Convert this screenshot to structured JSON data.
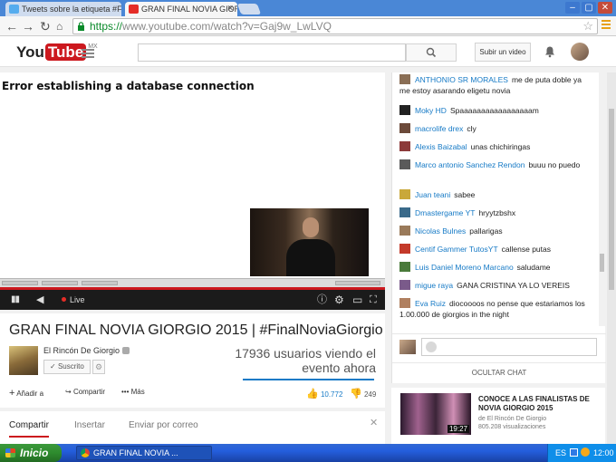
{
  "browser": {
    "tabs": [
      {
        "title": "Tweets sobre la etiqueta #Fi",
        "active": false
      },
      {
        "title": "GRAN FINAL NOVIA GIOR",
        "active": true
      }
    ],
    "url_scheme": "https://",
    "url_rest": "www.youtube.com/watch?v=Gaj9w_LwLVQ"
  },
  "yt_header": {
    "logo_you": "You",
    "logo_tube": "Tube",
    "logo_region": "MX",
    "upload_label": "Subir un video"
  },
  "player": {
    "error_text": "Error establishing a database connection",
    "live_label": "Live"
  },
  "video": {
    "title": "GRAN FINAL NOVIA GIORGIO 2015 | #FinalNoviaGiorgio",
    "channel": "El Rincón De Giorgio",
    "subscribe_label": "Suscrito",
    "viewers": "17936 usuarios viendo el evento ahora",
    "add_label": "Añadir a",
    "share_label": "Compartir",
    "more_label": "Más",
    "likes": "10.772",
    "dislikes": "249"
  },
  "share_tabs": [
    "Compartir",
    "Insertar",
    "Enviar por correo"
  ],
  "chat": {
    "messages": [
      {
        "user": "ANTHONIO SR MORALES",
        "text": "me de puta doble ya me estoy asarando eligetu novia"
      },
      {
        "user": "Moky HD",
        "text": "Spaaaaaaaaaaaaaaaaam"
      },
      {
        "user": "macrolife drex",
        "text": "cly"
      },
      {
        "user": "Alexis Baizabal",
        "text": "unas chichiringas"
      },
      {
        "user": "Marco antonio Sanchez Rendon",
        "text": "buuu no puedo"
      },
      {
        "user": "Juan teani",
        "text": "sabee"
      },
      {
        "user": "Dmastergame YT",
        "text": "hryytzbshx"
      },
      {
        "user": "Nicolas Bulnes",
        "text": "pallarigas"
      },
      {
        "user": "Centif Gammer TutosYT",
        "text": "callense putas"
      },
      {
        "user": "Luis Daniel Moreno Marcano",
        "text": "saludame"
      },
      {
        "user": "migue raya",
        "text": "GANA CRISTINA YA LO VEREIS"
      },
      {
        "user": "Eva Ruiz",
        "text": "diocoooos no pense que estariamos los 1.00.000 de giorgios in the night"
      }
    ],
    "hide_label": "OCULTAR CHAT"
  },
  "related": {
    "title": "CONOCE A LAS FINALISTAS DE NOVIA GIORGIO 2015",
    "channel": "de El Rincón De Giorgio",
    "views": "805.208 visualizaciones",
    "duration": "19:27"
  },
  "taskbar": {
    "start_label": "Inicio",
    "item_label": "GRAN FINAL NOVIA ...",
    "lang": "ES",
    "clock": "12:00"
  }
}
